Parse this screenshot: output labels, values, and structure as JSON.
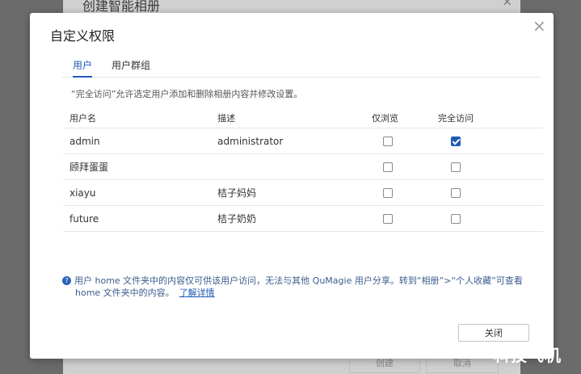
{
  "background": {
    "title": "创建智能相册",
    "close_glyph": "×",
    "create_label": "创建",
    "cancel_label": "取消"
  },
  "dialog": {
    "title": "自定义权限",
    "close_glyph": "×",
    "tabs": [
      {
        "label": "用户",
        "active": true
      },
      {
        "label": "用户群组",
        "active": false
      }
    ],
    "description": "“完全访问”允许选定用户添加和删除相册内容并修改设置。",
    "table": {
      "headers": [
        "用户名",
        "描述",
        "仅浏览",
        "完全访问"
      ],
      "rows": [
        {
          "name": "admin",
          "description": "administrator",
          "view_only": false,
          "full_access": true
        },
        {
          "name": "顾拜蛋蛋",
          "description": "",
          "view_only": false,
          "full_access": false
        },
        {
          "name": "xiayu",
          "description": "桔子妈妈",
          "view_only": false,
          "full_access": false
        },
        {
          "name": "future",
          "description": "桔子奶奶",
          "view_only": false,
          "full_access": false
        }
      ]
    },
    "info": {
      "line1": "用户 home 文件夹中的内容仅可供该用户访问，无法与其他 QuMagie 用户分享。转到“相册”>“个人收藏”可查看",
      "line2": "home 文件夹中的内容。",
      "link": "了解详情"
    },
    "close_button": "关闭"
  },
  "watermark": "科技飞机",
  "colors": {
    "accent": "#1f5bb5",
    "info_text": "#3b5d8f",
    "overlay": "#6b6b6b"
  }
}
